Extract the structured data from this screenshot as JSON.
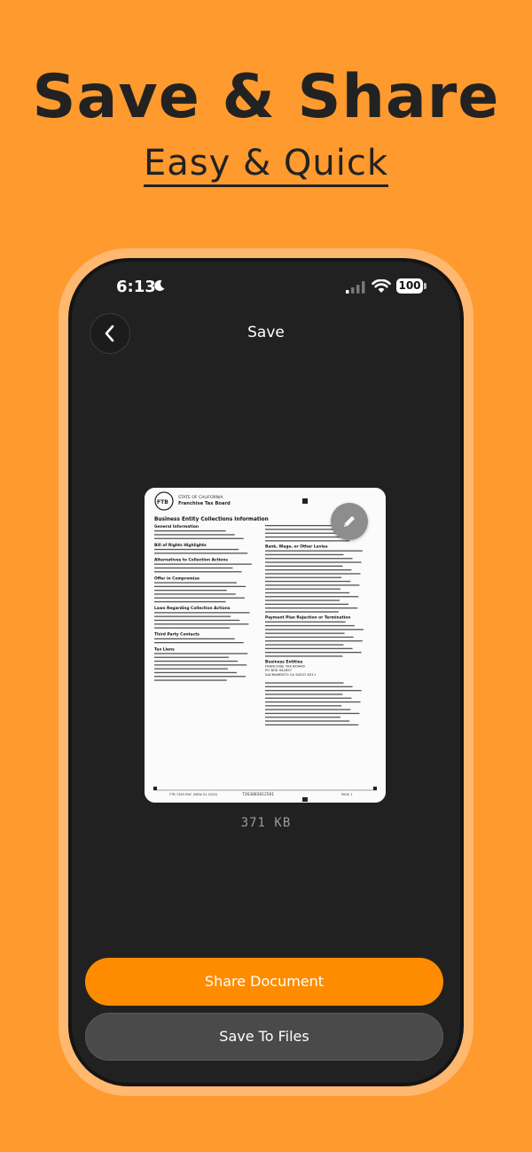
{
  "promo": {
    "headline": "Save & Share",
    "subheadline": "Easy & Quick"
  },
  "status_bar": {
    "time": "6:13",
    "battery": "100"
  },
  "nav": {
    "title": "Save"
  },
  "document": {
    "header_line1": "STATE OF CALIFORNIA",
    "header_line2": "Franchise Tax Board",
    "title": "Business Entity Collections Information",
    "sections_left": [
      "General Information",
      "Bill of Rights Highlights",
      "Alternatives to Collection Actions",
      "Offer in Compromise",
      "Laws Regarding Collection Actions",
      "Third Party Contacts",
      "Tax Liens"
    ],
    "sections_right": [
      "Bank, Wage, or Other Levies",
      "Payment Plan Rejection or Termination",
      "Business Entities",
      "FRANCHISE TAX BOARD",
      "PO BOX 942857",
      "SACRAMENTO CA 94257-0511"
    ],
    "footer_left": "FTB 7263 ENC (NEW 01-2020)",
    "footer_center": "7263002012581",
    "footer_right": "PAGE 1",
    "file_size": "371 KB"
  },
  "actions": {
    "share_label": "Share Document",
    "save_label": "Save To Files"
  },
  "colors": {
    "background": "#FF9A2E",
    "accent": "#FF8C00",
    "screen": "#212121",
    "secondary_button": "#4a4a4a"
  },
  "icons": {
    "back": "chevron-left-icon",
    "edit": "pencil-icon",
    "moon": "moon-icon",
    "signal": "cellular-signal-icon",
    "wifi": "wifi-icon",
    "battery": "battery-icon"
  }
}
